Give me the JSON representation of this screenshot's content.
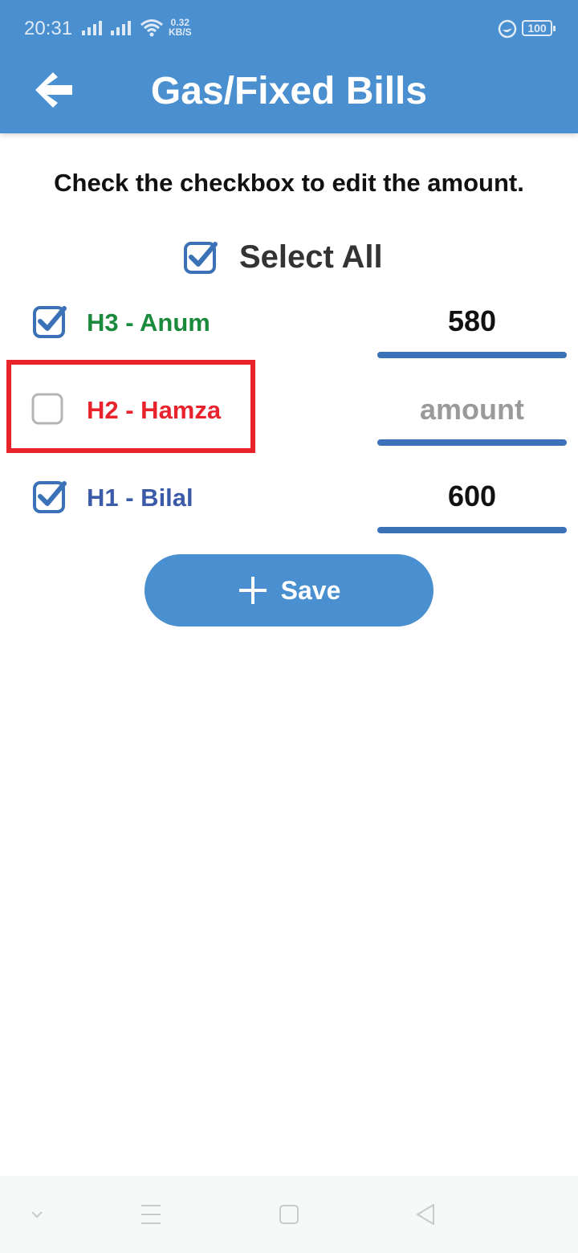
{
  "status_bar": {
    "time": "20:31",
    "net_speed_value": "0.32",
    "net_speed_unit": "KB/S",
    "battery": "100"
  },
  "header": {
    "title": "Gas/Fixed Bills",
    "background": "#4a8fcf"
  },
  "instruction": "Check the checkbox to edit the amount.",
  "select_all": {
    "label": "Select All",
    "checked": true
  },
  "rows": [
    {
      "label": "H3 - Anum",
      "color": "#1a8a3c",
      "checked": true,
      "amount": "580",
      "placeholder": "amount"
    },
    {
      "label": "H2 - Hamza",
      "color": "#e8232c",
      "checked": false,
      "amount": "",
      "placeholder": "amount"
    },
    {
      "label": "H1 - Bilal",
      "color": "#3b5aa8",
      "checked": true,
      "amount": "600",
      "placeholder": "amount"
    }
  ],
  "save_button": {
    "label": "Save",
    "icon": "plus-icon"
  },
  "nav_bar": {
    "icons": [
      "chevron-down-icon",
      "menu-icon",
      "home-square-icon",
      "back-triangle-icon"
    ]
  }
}
